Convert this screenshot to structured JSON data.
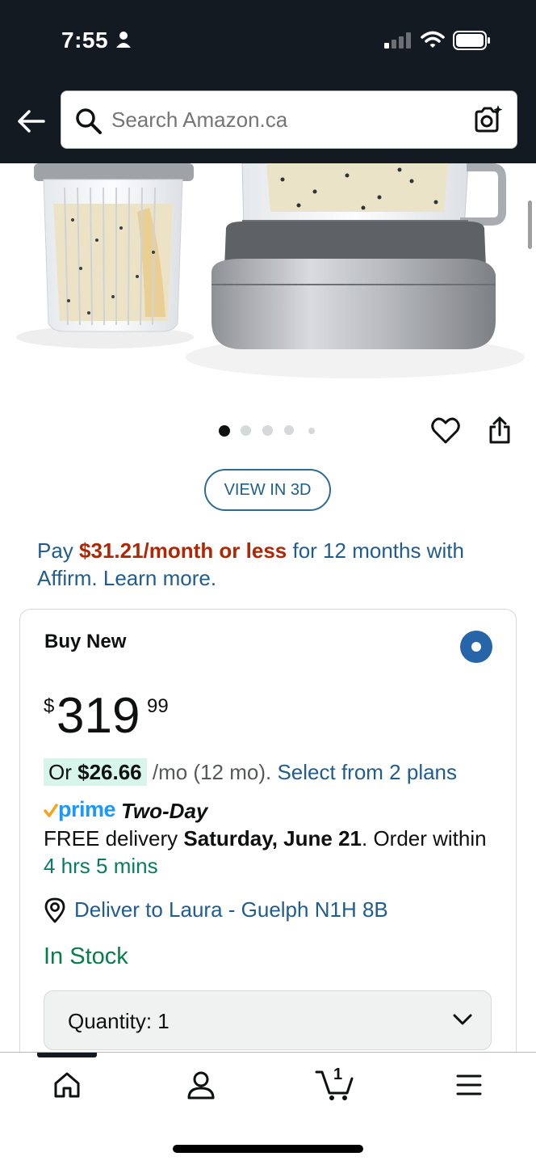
{
  "status": {
    "time": "7:55"
  },
  "search": {
    "placeholder": "Search Amazon.ca"
  },
  "product": {
    "view3d_label": "VIEW IN 3D",
    "image_count": 5,
    "selected_image": 1
  },
  "affirm": {
    "prefix": "Pay ",
    "amount": "$31.21/month or less",
    "suffix": " for 12 months with Affirm. Learn more."
  },
  "buybox": {
    "title": "Buy New",
    "price_symbol": "$",
    "price_whole": "319",
    "price_fraction": "99",
    "monthly_prefix": "Or ",
    "monthly_amount": "$26.66",
    "monthly_suffix": " /mo (12 mo). ",
    "monthly_link": "Select from 2 plans",
    "prime_word": "prime",
    "prime_speed": "Two-Day",
    "delivery_pre": "FREE delivery ",
    "delivery_date": "Saturday, June 21",
    "delivery_mid": ". Order within ",
    "delivery_window": "4 hrs 5 mins",
    "deliver_to": "Deliver to Laura - Guelph N1H 8B",
    "stock": "In Stock",
    "quantity_label": "Quantity:",
    "quantity_value": "1"
  },
  "tabbar": {
    "cart_count": "1"
  },
  "colors": {
    "nav": "#131a22",
    "link": "#1f5d90",
    "price_red": "#b12704",
    "stock_green": "#067d4b",
    "radio": "#2565a8"
  },
  "icons": [
    "person-icon",
    "signal-icon",
    "wifi-icon",
    "battery-icon",
    "back-arrow-icon",
    "search-icon",
    "camera-icon",
    "heart-icon",
    "share-icon",
    "radio-selected-icon",
    "prime-check-icon",
    "location-pin-icon",
    "chevron-down-icon",
    "home-icon",
    "account-icon",
    "cart-icon",
    "menu-icon"
  ]
}
